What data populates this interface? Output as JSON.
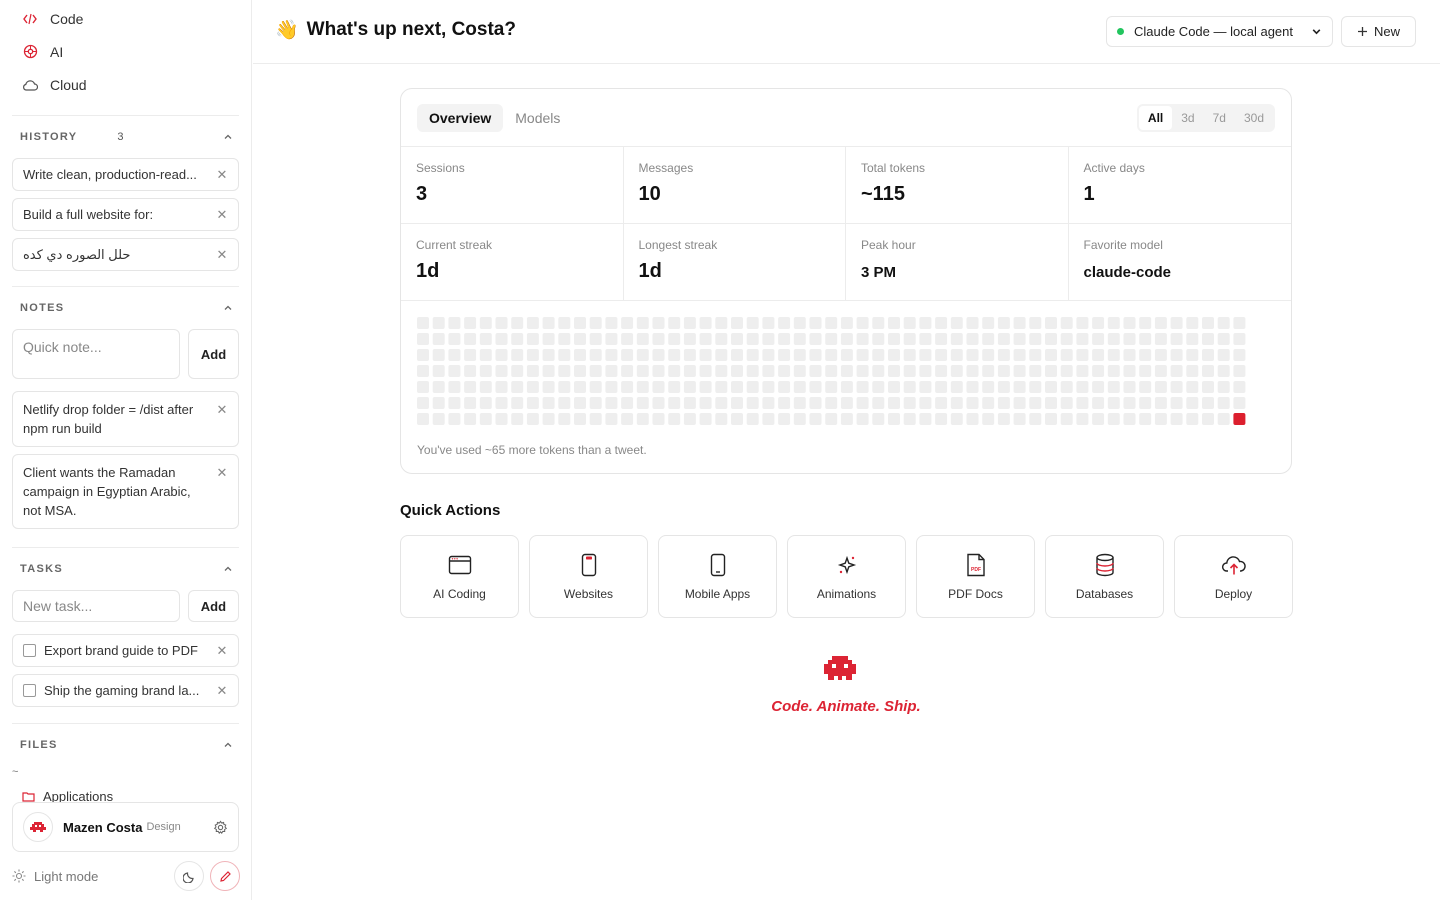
{
  "sidebar": {
    "nav": [
      {
        "label": "Code",
        "icon": "code-icon"
      },
      {
        "label": "AI",
        "icon": "ai-icon"
      },
      {
        "label": "Cloud",
        "icon": "cloud-icon"
      }
    ],
    "history": {
      "title": "HISTORY",
      "count": "3",
      "items": [
        "Write clean, production-read...",
        "Build a full website for:",
        "حلل الصوره دي كده"
      ]
    },
    "notes": {
      "title": "NOTES",
      "placeholder": "Quick note...",
      "add_label": "Add",
      "items": [
        "Netlify drop folder = /dist after npm run build",
        "Client wants the Ramadan campaign in Egyptian Arabic, not MSA."
      ]
    },
    "tasks": {
      "title": "TASKS",
      "placeholder": "New task...",
      "add_label": "Add",
      "items": [
        "Export brand guide to PDF",
        "Ship the gaming brand la..."
      ]
    },
    "files": {
      "title": "FILES",
      "root": "~",
      "items": [
        "Applications"
      ]
    },
    "user": {
      "name": "Mazen Costa",
      "role": "Design"
    },
    "theme_label": "Light mode"
  },
  "header": {
    "emoji": "👋",
    "greeting": "What's up next, Costa?",
    "agent": "Claude Code — local agent",
    "new_label": "New"
  },
  "stats": {
    "tabs": [
      "Overview",
      "Models"
    ],
    "ranges": [
      "All",
      "3d",
      "7d",
      "30d"
    ],
    "active_range": "All",
    "cards": [
      {
        "label": "Sessions",
        "value": "3"
      },
      {
        "label": "Messages",
        "value": "10"
      },
      {
        "label": "Total tokens",
        "value": "~115"
      },
      {
        "label": "Active days",
        "value": "1"
      },
      {
        "label": "Current streak",
        "value": "1d"
      },
      {
        "label": "Longest streak",
        "value": "1d"
      },
      {
        "label": "Peak hour",
        "value": "3 PM"
      },
      {
        "label": "Favorite model",
        "value": "claude-code"
      }
    ],
    "heatmap": {
      "weeks": 53,
      "days": 7,
      "active_week": 52,
      "active_day": 6,
      "active_color": "#dc1f2e",
      "empty_color": "#eeeeee"
    },
    "footnote": "You've used ~65 more tokens than a tweet."
  },
  "quick_actions": {
    "title": "Quick Actions",
    "items": [
      {
        "label": "AI Coding",
        "icon": "browser-code-icon"
      },
      {
        "label": "Websites",
        "icon": "phone-web-icon"
      },
      {
        "label": "Mobile Apps",
        "icon": "mobile-icon"
      },
      {
        "label": "Animations",
        "icon": "sparkle-icon"
      },
      {
        "label": "PDF Docs",
        "icon": "pdf-icon"
      },
      {
        "label": "Databases",
        "icon": "database-icon"
      },
      {
        "label": "Deploy",
        "icon": "cloud-upload-icon"
      }
    ]
  },
  "brand": {
    "tagline": "Code. Animate. Ship.",
    "accent": "#dc2434"
  }
}
